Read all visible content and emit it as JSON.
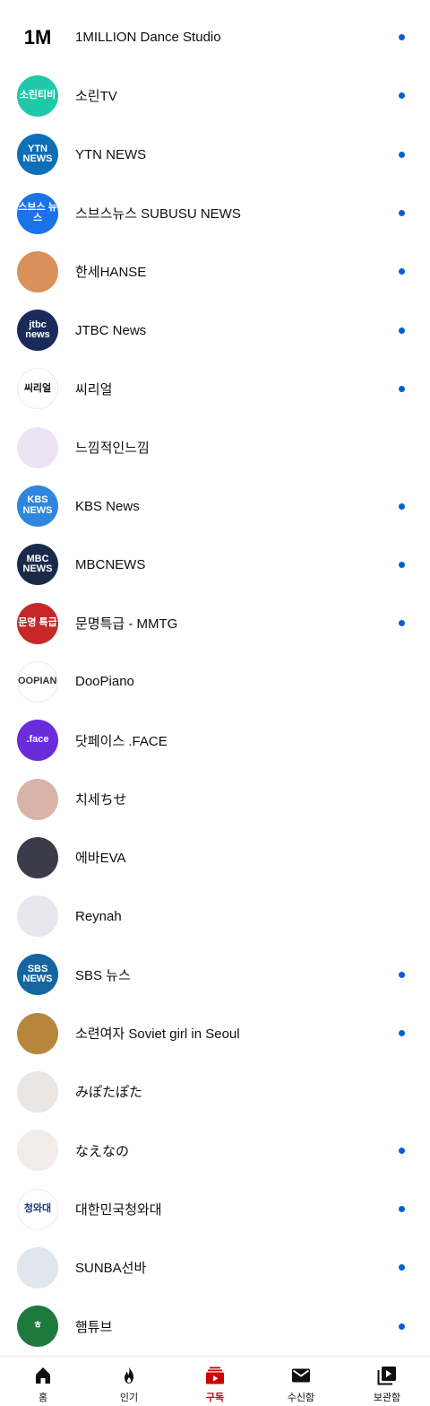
{
  "subscriptions": [
    {
      "name": "1MILLION Dance Studio",
      "avatar_text": "1M",
      "avatar_bg": "#ffffff",
      "avatar_fg": "#000000",
      "new": true
    },
    {
      "name": "소린TV",
      "avatar_text": "소린티비",
      "avatar_bg": "#1fc8a8",
      "avatar_fg": "#ffffff",
      "new": true
    },
    {
      "name": "YTN NEWS",
      "avatar_text": "YTN NEWS",
      "avatar_bg": "#0d6fb8",
      "avatar_fg": "#ffffff",
      "new": true
    },
    {
      "name": "스브스뉴스 SUBUSU NEWS",
      "avatar_text": "스브스 뉴스",
      "avatar_bg": "#1a73e8",
      "avatar_fg": "#ffffff",
      "new": true
    },
    {
      "name": "한세HANSE",
      "avatar_text": "",
      "avatar_bg": "#d9905a",
      "avatar_fg": "#ffffff",
      "new": true
    },
    {
      "name": "JTBC News",
      "avatar_text": "jtbc news",
      "avatar_bg": "#1a2a5a",
      "avatar_fg": "#ffffff",
      "new": true
    },
    {
      "name": "씨리얼",
      "avatar_text": "씨리얼",
      "avatar_bg": "#ffffff",
      "avatar_fg": "#111111",
      "new": true
    },
    {
      "name": "느낌적인느낌",
      "avatar_text": "",
      "avatar_bg": "#ece4f4",
      "avatar_fg": "#7a4fb0",
      "new": false
    },
    {
      "name": "KBS News",
      "avatar_text": "KBS NEWS",
      "avatar_bg": "#2e86de",
      "avatar_fg": "#ffffff",
      "new": true
    },
    {
      "name": "MBCNEWS",
      "avatar_text": "MBC NEWS",
      "avatar_bg": "#1b2a49",
      "avatar_fg": "#ffffff",
      "new": true
    },
    {
      "name": "문명특급 - MMTG",
      "avatar_text": "문명 특급",
      "avatar_bg": "#c62828",
      "avatar_fg": "#ffffff",
      "new": true
    },
    {
      "name": "DooPiano",
      "avatar_text": "DOOPIANO",
      "avatar_bg": "#ffffff",
      "avatar_fg": "#333333",
      "new": false
    },
    {
      "name": "닷페이스 .FACE",
      "avatar_text": ".face",
      "avatar_bg": "#6a2bd9",
      "avatar_fg": "#ffffff",
      "new": false
    },
    {
      "name": "치세ちせ",
      "avatar_text": "",
      "avatar_bg": "#d8b4a8",
      "avatar_fg": "#ffffff",
      "new": false
    },
    {
      "name": "에바EVA",
      "avatar_text": "",
      "avatar_bg": "#3b3b4a",
      "avatar_fg": "#ffffff",
      "new": false
    },
    {
      "name": "Reynah",
      "avatar_text": "",
      "avatar_bg": "#e8e6ee",
      "avatar_fg": "#555555",
      "new": false
    },
    {
      "name": "SBS 뉴스",
      "avatar_text": "SBS NEWS",
      "avatar_bg": "#1565a0",
      "avatar_fg": "#ffffff",
      "new": true
    },
    {
      "name": "소련여자 Soviet girl in Seoul",
      "avatar_text": "",
      "avatar_bg": "#b8863b",
      "avatar_fg": "#ffffff",
      "new": true
    },
    {
      "name": "みぽたぽた",
      "avatar_text": "",
      "avatar_bg": "#e9e6e4",
      "avatar_fg": "#555555",
      "new": false
    },
    {
      "name": "なえなの",
      "avatar_text": "",
      "avatar_bg": "#f1ecea",
      "avatar_fg": "#555555",
      "new": true
    },
    {
      "name": "대한민국청와대",
      "avatar_text": "청와대",
      "avatar_bg": "#ffffff",
      "avatar_fg": "#1f3a6e",
      "new": true
    },
    {
      "name": "SUNBA선바",
      "avatar_text": "",
      "avatar_bg": "#dfe6ee",
      "avatar_fg": "#333333",
      "new": true
    },
    {
      "name": "햄튜브",
      "avatar_text": "ㅎ",
      "avatar_bg": "#1e7a3a",
      "avatar_fg": "#ffffff",
      "new": true
    }
  ],
  "bottom_nav": [
    {
      "label": "홈",
      "icon": "home-icon",
      "active": false
    },
    {
      "label": "인기",
      "icon": "explore-fire-icon",
      "active": false
    },
    {
      "label": "구독",
      "icon": "subscriptions-icon",
      "active": true
    },
    {
      "label": "수신함",
      "icon": "inbox-icon",
      "active": false
    },
    {
      "label": "보관함",
      "icon": "library-icon",
      "active": false
    }
  ],
  "colors": {
    "new_dot": "#065fd4",
    "active": "#cc0000"
  }
}
